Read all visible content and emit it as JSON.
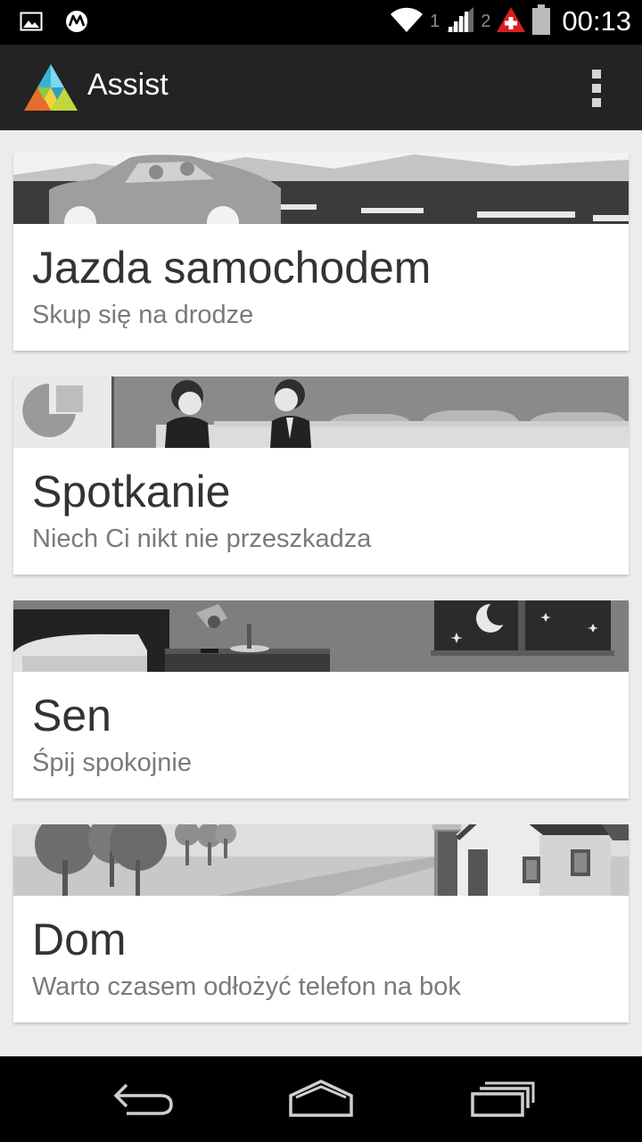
{
  "statusbar": {
    "sim1": "1",
    "sim2": "2",
    "time": "00:13",
    "icons": [
      "gallery-icon",
      "motorola-icon",
      "wifi-icon",
      "signal-icon",
      "signal-icon",
      "swiss-carrier-icon",
      "battery-icon"
    ]
  },
  "actionbar": {
    "title": "Assist",
    "logo": "assist-logo",
    "menu_icon": "overflow-menu-icon"
  },
  "cards": [
    {
      "title": "Jazda samochodem",
      "subtitle": "Skup się na drodze",
      "banner": "driving-illustration"
    },
    {
      "title": "Spotkanie",
      "subtitle": "Niech Ci nikt nie przeszkadza",
      "banner": "meeting-illustration"
    },
    {
      "title": "Sen",
      "subtitle": "Śpij spokojnie",
      "banner": "sleep-illustration"
    },
    {
      "title": "Dom",
      "subtitle": "Warto czasem odłożyć telefon na bok",
      "banner": "home-illustration"
    }
  ],
  "navbar": {
    "icons": [
      "back-icon",
      "home-icon",
      "recent-apps-icon"
    ]
  },
  "colors": {
    "actionbar_bg": "#232323",
    "content_bg": "#ececec",
    "card_bg": "#ffffff",
    "title_text": "#333333",
    "subtitle_text": "#7a7a7a"
  }
}
